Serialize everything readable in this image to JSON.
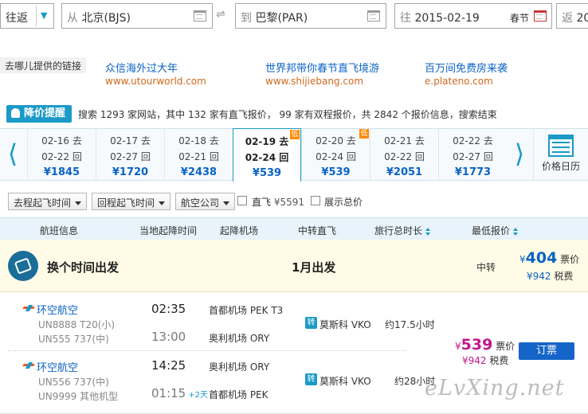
{
  "search": {
    "trip_type": "往返",
    "from_prefix": "从",
    "from_city": "北京(BJS)",
    "to_prefix": "到",
    "to_city": "巴黎(PAR)",
    "depart_prefix": "往",
    "depart_date": "2015-02-19",
    "depart_note": "春节",
    "return_prefix": "返",
    "return_date": "20"
  },
  "ads": {
    "label": "去哪儿提供的链接",
    "items": [
      {
        "title": "众信海外过大年",
        "url": "www.utourworld.com"
      },
      {
        "title": "世界邦带你春节直飞境游",
        "url": "www.shijiebang.com"
      },
      {
        "title": "百万间免费房来袭",
        "url": "e.plateno.com"
      }
    ]
  },
  "alert": {
    "label": "降价提醒",
    "summary": "搜索 1293 家网站，其中 132 家有直飞报价， 99 家有双程报价，共 2842 个报价信息，搜索结束"
  },
  "dates": [
    {
      "depart": "02-16 去",
      "return": "02-22 回",
      "price": "¥1845",
      "low": false,
      "selected": false
    },
    {
      "depart": "02-17 去",
      "return": "02-27 回",
      "price": "¥1720",
      "low": false,
      "selected": false
    },
    {
      "depart": "02-18 去",
      "return": "02-21 回",
      "price": "¥2438",
      "low": false,
      "selected": false
    },
    {
      "depart": "02-19 去",
      "return": "02-24 回",
      "price": "¥539",
      "low": true,
      "selected": true
    },
    {
      "depart": "02-20 去",
      "return": "02-24 回",
      "price": "¥539",
      "low": true,
      "selected": false
    },
    {
      "depart": "02-21 去",
      "return": "02-22 回",
      "price": "¥2051",
      "low": false,
      "selected": false
    },
    {
      "depart": "02-22 去",
      "return": "02-27 回",
      "price": "¥1773",
      "low": false,
      "selected": false
    }
  ],
  "low_badge": "低",
  "price_calendar": "价格日历",
  "filters": {
    "depart_time": "去程起飞时间",
    "return_time": "回程起飞时间",
    "airline": "航空公司",
    "direct": "直飞",
    "direct_price": "¥5591",
    "show_total": "展示总价"
  },
  "table_header": {
    "flight_info": "航班信息",
    "local_time": "当地起降时间",
    "airport": "起降机场",
    "transit": "中转直飞",
    "duration": "旅行总时长",
    "price": "最低报价"
  },
  "promo": {
    "title": "换个时间出发",
    "month": "1月出发",
    "transit": "中转",
    "currency": "¥",
    "price": "404",
    "price_label": "票价",
    "tax": "¥942",
    "tax_label": "税费"
  },
  "flight": {
    "outbound": {
      "airline": "环空航空",
      "flight1": "UN8888 T20(小)",
      "flight2": "UN555 737(中)",
      "dep_time": "02:35",
      "arr_time": "13:00",
      "dep_airport": "首都机场 PEK T3",
      "arr_airport": "奥利机场 ORY",
      "transit_icon": "转",
      "transit": "莫斯科 VKO",
      "duration": "约17.5小时"
    },
    "inbound": {
      "airline": "环空航空",
      "flight1": "UN556 737(中)",
      "flight2": "UN9999 其他机型",
      "dep_time": "14:25",
      "arr_time": "01:15",
      "day_offset": "+2天",
      "dep_airport": "奥利机场 ORY",
      "arr_airport": "首都机场 PEK",
      "transit_icon": "转",
      "transit": "莫斯科 VKO",
      "duration": "约28小时"
    },
    "currency": "¥",
    "price": "539",
    "price_label": "票价",
    "tax": "¥942",
    "tax_label": "税费",
    "book_label": "订票"
  },
  "watermark": "eLvXing.net",
  "colors": {
    "accent": "#1a9ac6",
    "link": "#0b63c5",
    "ad_url": "#d2681e",
    "price": "#c2168a",
    "book": "#1565c8"
  }
}
